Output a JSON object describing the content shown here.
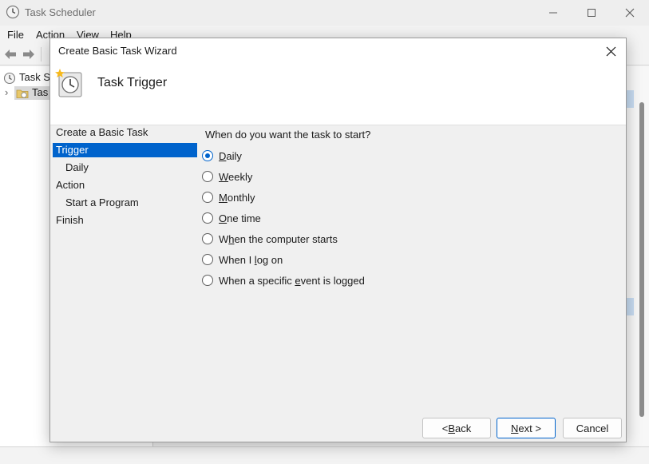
{
  "app": {
    "title": "Task Scheduler",
    "menu": [
      "File",
      "Action",
      "View",
      "Help"
    ],
    "tree": {
      "root_label": "Task Sc",
      "child_label": "Tas"
    }
  },
  "dialog": {
    "title": "Create Basic Task Wizard",
    "header_title": "Task Trigger",
    "steps": [
      {
        "label": "Create a Basic Task",
        "sub": false,
        "active": false
      },
      {
        "label": "Trigger",
        "sub": false,
        "active": true
      },
      {
        "label": "Daily",
        "sub": true,
        "active": false
      },
      {
        "label": "Action",
        "sub": false,
        "active": false
      },
      {
        "label": "Start a Program",
        "sub": true,
        "active": false
      },
      {
        "label": "Finish",
        "sub": false,
        "active": false
      }
    ],
    "question": "When do you want the task to start?",
    "options": [
      {
        "pre": "",
        "key": "D",
        "post": "aily",
        "checked": true
      },
      {
        "pre": "",
        "key": "W",
        "post": "eekly",
        "checked": false
      },
      {
        "pre": "",
        "key": "M",
        "post": "onthly",
        "checked": false
      },
      {
        "pre": "",
        "key": "O",
        "post": "ne time",
        "checked": false
      },
      {
        "pre": "W",
        "key": "h",
        "post": "en the computer starts",
        "checked": false
      },
      {
        "pre": "When I ",
        "key": "l",
        "post": "og on",
        "checked": false
      },
      {
        "pre": "When a specific ",
        "key": "e",
        "post": "vent is logged",
        "checked": false
      }
    ],
    "buttons": {
      "back": {
        "pre": "< ",
        "key": "B",
        "post": "ack"
      },
      "next": {
        "pre": "",
        "key": "N",
        "post": "ext >"
      },
      "cancel": "Cancel"
    }
  },
  "colors": {
    "accent": "#0063cc",
    "selection_text": "#ffffff"
  }
}
